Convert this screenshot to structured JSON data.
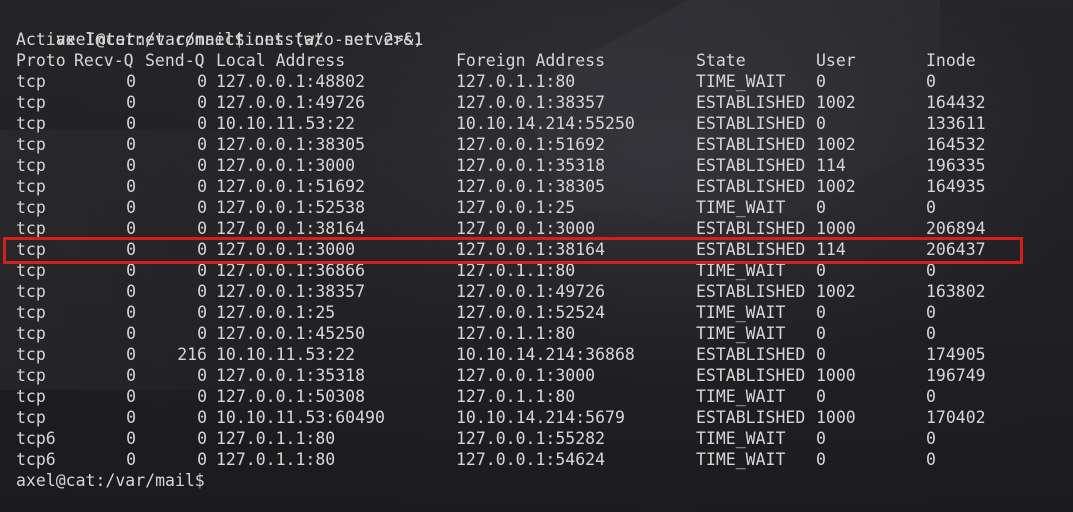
{
  "prompt_user_host": "axel@cat:/var/mail$",
  "command": " netstat -net 2>&1",
  "summary_line": "Active Internet connections (w/o servers)",
  "headers": {
    "proto": "Proto",
    "recvq": "Recv-Q",
    "sendq": "Send-Q",
    "local": "Local Address",
    "foreign": "Foreign Address",
    "state": "State",
    "user": "User",
    "inode": "Inode"
  },
  "rows": [
    {
      "proto": "tcp",
      "recvq": "0",
      "sendq": "0",
      "local": "127.0.0.1:48802",
      "foreign": "127.0.1.1:80",
      "state": "TIME_WAIT",
      "user": "0",
      "inode": "0"
    },
    {
      "proto": "tcp",
      "recvq": "0",
      "sendq": "0",
      "local": "127.0.0.1:49726",
      "foreign": "127.0.0.1:38357",
      "state": "ESTABLISHED",
      "user": "1002",
      "inode": "164432"
    },
    {
      "proto": "tcp",
      "recvq": "0",
      "sendq": "0",
      "local": "10.10.11.53:22",
      "foreign": "10.10.14.214:55250",
      "state": "ESTABLISHED",
      "user": "0",
      "inode": "133611"
    },
    {
      "proto": "tcp",
      "recvq": "0",
      "sendq": "0",
      "local": "127.0.0.1:38305",
      "foreign": "127.0.0.1:51692",
      "state": "ESTABLISHED",
      "user": "1002",
      "inode": "164532"
    },
    {
      "proto": "tcp",
      "recvq": "0",
      "sendq": "0",
      "local": "127.0.0.1:3000",
      "foreign": "127.0.0.1:35318",
      "state": "ESTABLISHED",
      "user": "114",
      "inode": "196335"
    },
    {
      "proto": "tcp",
      "recvq": "0",
      "sendq": "0",
      "local": "127.0.0.1:51692",
      "foreign": "127.0.0.1:38305",
      "state": "ESTABLISHED",
      "user": "1002",
      "inode": "164935"
    },
    {
      "proto": "tcp",
      "recvq": "0",
      "sendq": "0",
      "local": "127.0.0.1:52538",
      "foreign": "127.0.0.1:25",
      "state": "TIME_WAIT",
      "user": "0",
      "inode": "0"
    },
    {
      "proto": "tcp",
      "recvq": "0",
      "sendq": "0",
      "local": "127.0.0.1:38164",
      "foreign": "127.0.0.1:3000",
      "state": "ESTABLISHED",
      "user": "1000",
      "inode": "206894"
    },
    {
      "proto": "tcp",
      "recvq": "0",
      "sendq": "0",
      "local": "127.0.0.1:3000",
      "foreign": "127.0.0.1:38164",
      "state": "ESTABLISHED",
      "user": "114",
      "inode": "206437",
      "highlighted": true
    },
    {
      "proto": "tcp",
      "recvq": "0",
      "sendq": "0",
      "local": "127.0.0.1:36866",
      "foreign": "127.0.1.1:80",
      "state": "TIME_WAIT",
      "user": "0",
      "inode": "0"
    },
    {
      "proto": "tcp",
      "recvq": "0",
      "sendq": "0",
      "local": "127.0.0.1:38357",
      "foreign": "127.0.0.1:49726",
      "state": "ESTABLISHED",
      "user": "1002",
      "inode": "163802"
    },
    {
      "proto": "tcp",
      "recvq": "0",
      "sendq": "0",
      "local": "127.0.0.1:25",
      "foreign": "127.0.0.1:52524",
      "state": "TIME_WAIT",
      "user": "0",
      "inode": "0"
    },
    {
      "proto": "tcp",
      "recvq": "0",
      "sendq": "0",
      "local": "127.0.0.1:45250",
      "foreign": "127.0.1.1:80",
      "state": "TIME_WAIT",
      "user": "0",
      "inode": "0"
    },
    {
      "proto": "tcp",
      "recvq": "0",
      "sendq": "216",
      "local": "10.10.11.53:22",
      "foreign": "10.10.14.214:36868",
      "state": "ESTABLISHED",
      "user": "0",
      "inode": "174905"
    },
    {
      "proto": "tcp",
      "recvq": "0",
      "sendq": "0",
      "local": "127.0.0.1:35318",
      "foreign": "127.0.0.1:3000",
      "state": "ESTABLISHED",
      "user": "1000",
      "inode": "196749"
    },
    {
      "proto": "tcp",
      "recvq": "0",
      "sendq": "0",
      "local": "127.0.0.1:50308",
      "foreign": "127.0.1.1:80",
      "state": "TIME_WAIT",
      "user": "0",
      "inode": "0"
    },
    {
      "proto": "tcp",
      "recvq": "0",
      "sendq": "0",
      "local": "10.10.11.53:60490",
      "foreign": "10.10.14.214:5679",
      "state": "ESTABLISHED",
      "user": "1000",
      "inode": "170402"
    },
    {
      "proto": "tcp6",
      "recvq": "0",
      "sendq": "0",
      "local": "127.0.1.1:80",
      "foreign": "127.0.0.1:55282",
      "state": "TIME_WAIT",
      "user": "0",
      "inode": "0"
    },
    {
      "proto": "tcp6",
      "recvq": "0",
      "sendq": "0",
      "local": "127.0.1.1:80",
      "foreign": "127.0.0.1:54624",
      "state": "TIME_WAIT",
      "user": "0",
      "inode": "0"
    }
  ],
  "final_prompt": "axel@cat:/var/mail$",
  "colors": {
    "text": "#d6d6d6",
    "background": "#202022",
    "highlight_border": "#d41f1f"
  }
}
